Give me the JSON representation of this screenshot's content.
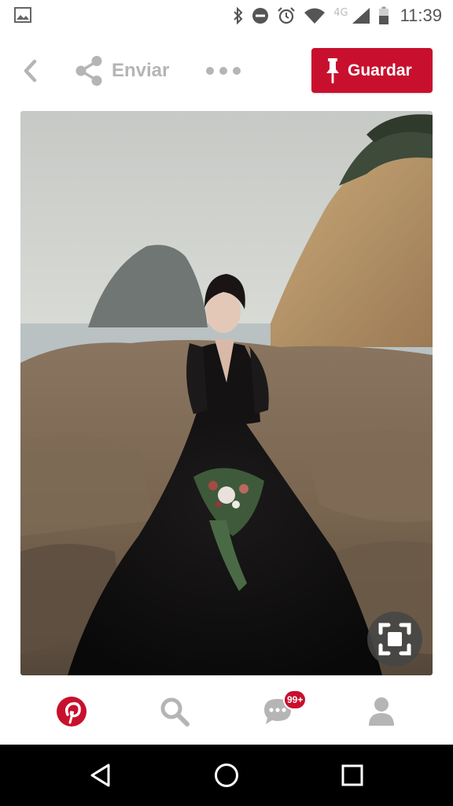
{
  "status_bar": {
    "network": "4G",
    "time": "11:39",
    "icons": [
      "gallery-icon",
      "bluetooth-icon",
      "do-not-disturb-icon",
      "alarm-icon",
      "wifi-icon",
      "signal-icon",
      "battery-icon"
    ]
  },
  "toolbar": {
    "back_icon": "chevron-left-icon",
    "send_label": "Enviar",
    "send_icon": "share-icon",
    "more_icon": "more-dots-icon",
    "save_label": "Guardar",
    "save_icon": "pushpin-icon"
  },
  "pin": {
    "image": "photo-bride-black-lace-gown-on-coastal-rocks",
    "visual_search_icon": "visual-search-icon"
  },
  "bottom_nav": {
    "items": [
      {
        "name": "home",
        "icon": "pinterest-logo-icon"
      },
      {
        "name": "search",
        "icon": "search-icon"
      },
      {
        "name": "messages",
        "icon": "chat-bubble-icon"
      },
      {
        "name": "profile",
        "icon": "user-icon"
      }
    ],
    "messages_badge": "99+"
  },
  "android_nav": {
    "buttons": [
      "back-triangle-icon",
      "home-circle-icon",
      "recents-square-icon"
    ]
  },
  "colors": {
    "accent": "#c8102e",
    "muted_icon": "#b5b5b5",
    "nav_bar": "#000000"
  }
}
